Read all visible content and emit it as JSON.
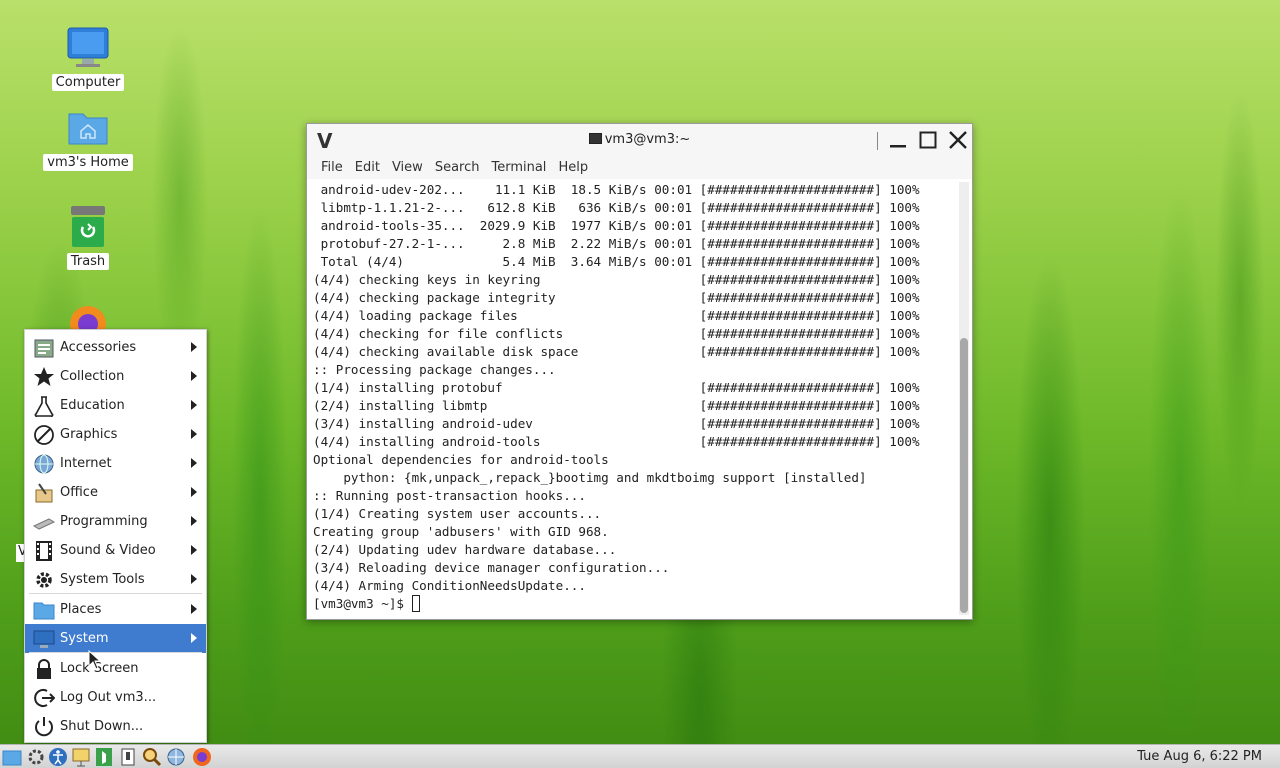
{
  "desktop": {
    "icons": [
      {
        "label": "Computer",
        "icon": "computer-icon"
      },
      {
        "label": "vm3's Home",
        "icon": "home-folder-icon"
      },
      {
        "label": "Trash",
        "icon": "trash-icon"
      }
    ],
    "partial_label": "V"
  },
  "terminal": {
    "title": "vm3@vm3:~",
    "menu": [
      "File",
      "Edit",
      "View",
      "Search",
      "Terminal",
      "Help"
    ],
    "lines": [
      " android-udev-202...    11.1 KiB  18.5 KiB/s 00:01 [######################] 100%",
      " libmtp-1.1.21-2-...   612.8 KiB   636 KiB/s 00:01 [######################] 100%",
      " android-tools-35...  2029.9 KiB  1977 KiB/s 00:01 [######################] 100%",
      " protobuf-27.2-1-...     2.8 MiB  2.22 MiB/s 00:01 [######################] 100%",
      " Total (4/4)             5.4 MiB  3.64 MiB/s 00:01 [######################] 100%",
      "(4/4) checking keys in keyring                     [######################] 100%",
      "(4/4) checking package integrity                   [######################] 100%",
      "(4/4) loading package files                        [######################] 100%",
      "(4/4) checking for file conflicts                  [######################] 100%",
      "(4/4) checking available disk space                [######################] 100%",
      ":: Processing package changes...",
      "(1/4) installing protobuf                          [######################] 100%",
      "(2/4) installing libmtp                            [######################] 100%",
      "(3/4) installing android-udev                      [######################] 100%",
      "(4/4) installing android-tools                     [######################] 100%",
      "Optional dependencies for android-tools",
      "    python: {mk,unpack_,repack_}bootimg and mkdtboimg support [installed]",
      ":: Running post-transaction hooks...",
      "(1/4) Creating system user accounts...",
      "Creating group 'adbusers' with GID 968.",
      "(2/4) Updating udev hardware database...",
      "(3/4) Reloading device manager configuration...",
      "(4/4) Arming ConditionNeedsUpdate..."
    ],
    "prompt": "[vm3@vm3 ~]$ "
  },
  "app_menu": {
    "items": [
      {
        "label": "Accessories",
        "icon": "accessories-icon",
        "submenu": true
      },
      {
        "label": "Collection",
        "icon": "star-icon",
        "submenu": true
      },
      {
        "label": "Education",
        "icon": "flask-icon",
        "submenu": true
      },
      {
        "label": "Graphics",
        "icon": "graphics-icon",
        "submenu": true
      },
      {
        "label": "Internet",
        "icon": "globe-icon",
        "submenu": true
      },
      {
        "label": "Office",
        "icon": "office-icon",
        "submenu": true
      },
      {
        "label": "Programming",
        "icon": "programming-icon",
        "submenu": true
      },
      {
        "label": "Sound & Video",
        "icon": "film-icon",
        "submenu": true
      },
      {
        "label": "System Tools",
        "icon": "gear-icon",
        "submenu": true
      },
      {
        "label": "Places",
        "icon": "folder-icon",
        "submenu": true
      },
      {
        "label": "System",
        "icon": "monitor-icon",
        "submenu": true,
        "active": true
      },
      {
        "label": "Lock Screen",
        "icon": "lock-icon",
        "submenu": false
      },
      {
        "label": "Log Out vm3...",
        "icon": "logout-icon",
        "submenu": false
      },
      {
        "label": "Shut Down...",
        "icon": "power-icon",
        "submenu": false
      }
    ]
  },
  "taskbar": {
    "clock": "Tue Aug  6,  6:22 PM"
  },
  "colors": {
    "menu_active": "#3f7ccf",
    "taskbar_bg": "#e0e0e0"
  }
}
